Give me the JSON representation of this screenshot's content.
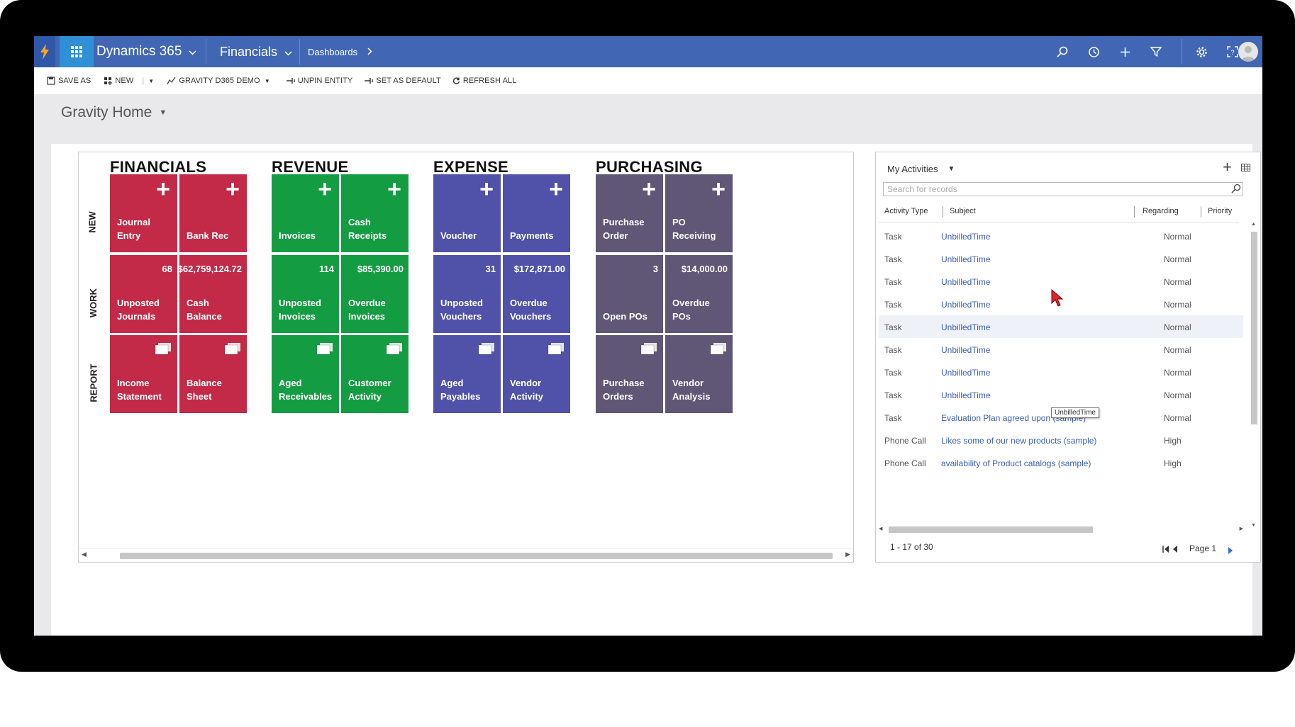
{
  "nav": {
    "app_name": "Dynamics 365",
    "area_name": "Financials",
    "breadcrumb": "Dashboards"
  },
  "toolbar": {
    "save_as": "SAVE AS",
    "new": "NEW",
    "demo": "GRAVITY D365 DEMO",
    "unpin": "UNPIN ENTITY",
    "set_default": "SET AS DEFAULT",
    "refresh": "REFRESH ALL"
  },
  "page_title": "Gravity Home",
  "row_labels": {
    "new": "NEW",
    "work": "WORK",
    "report": "REPORT"
  },
  "groups": [
    {
      "title": "FINANCIALS",
      "color": "#c22a47",
      "new": [
        {
          "label": "Journal Entry"
        },
        {
          "label": "Bank Rec"
        }
      ],
      "work": [
        {
          "value": "68",
          "label": "Unposted Journals"
        },
        {
          "value": "$62,759,124.72",
          "label": "Cash Balance"
        }
      ],
      "report": [
        {
          "label": "Income Statement"
        },
        {
          "label": "Balance Sheet"
        }
      ]
    },
    {
      "title": "REVENUE",
      "color": "#149c42",
      "new": [
        {
          "label": "Invoices"
        },
        {
          "label": "Cash Receipts"
        }
      ],
      "work": [
        {
          "value": "114",
          "label": "Unposted Invoices"
        },
        {
          "value": "$85,390.00",
          "label": "Overdue Invoices"
        }
      ],
      "report": [
        {
          "label": "Aged Receivables"
        },
        {
          "label": "Customer Activity"
        }
      ]
    },
    {
      "title": "EXPENSE",
      "color": "#4f52a8",
      "new": [
        {
          "label": "Voucher"
        },
        {
          "label": "Payments"
        }
      ],
      "work": [
        {
          "value": "31",
          "label": "Unposted Vouchers"
        },
        {
          "value": "$172,871.00",
          "label": "Overdue Vouchers"
        }
      ],
      "report": [
        {
          "label": "Aged Payables"
        },
        {
          "label": "Vendor Activity"
        }
      ]
    },
    {
      "title": "PURCHASING",
      "color": "#5f5775",
      "new": [
        {
          "label": "Purchase Order"
        },
        {
          "label": "PO Receiving"
        }
      ],
      "work": [
        {
          "value": "3",
          "label": "Open POs"
        },
        {
          "value": "$14,000.00",
          "label": "Overdue POs"
        }
      ],
      "report": [
        {
          "label": "Purchase Orders"
        },
        {
          "label": "Vendor Analysis"
        }
      ]
    }
  ],
  "activities": {
    "title": "My Activities",
    "search_placeholder": "Search for records",
    "columns": [
      "Activity Type",
      "Subject",
      "Regarding",
      "Priority"
    ],
    "rows": [
      {
        "type": "Task",
        "subject": "UnbilledTime",
        "priority": "Normal"
      },
      {
        "type": "Task",
        "subject": "UnbilledTime",
        "priority": "Normal"
      },
      {
        "type": "Task",
        "subject": "UnbilledTime",
        "priority": "Normal"
      },
      {
        "type": "Task",
        "subject": "UnbilledTime",
        "priority": "Normal"
      },
      {
        "type": "Task",
        "subject": "UnbilledTime",
        "priority": "Normal"
      },
      {
        "type": "Task",
        "subject": "UnbilledTime",
        "priority": "Normal"
      },
      {
        "type": "Task",
        "subject": "UnbilledTime",
        "priority": "Normal"
      },
      {
        "type": "Task",
        "subject": "UnbilledTime",
        "priority": "Normal"
      },
      {
        "type": "Task",
        "subject": "Evaluation Plan agreed upon (sample)",
        "priority": "Normal"
      },
      {
        "type": "Phone Call",
        "subject": "Likes some of our new products (sample)",
        "priority": "High"
      },
      {
        "type": "Phone Call",
        "subject": "availability of Product catalogs (sample)",
        "priority": "High"
      }
    ],
    "tooltip": "UnbilledTime",
    "record_count": "1 - 17 of 30",
    "page": "Page 1"
  }
}
